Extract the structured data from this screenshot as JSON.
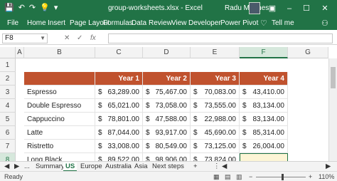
{
  "window": {
    "title": "group-worksheets.xlsx - Excel",
    "user": "Radu Meghes"
  },
  "ribbon": {
    "tabs": [
      "File",
      "Home",
      "Insert",
      "Page Layout",
      "Formulas",
      "Data",
      "Review",
      "View",
      "Developer",
      "Power Pivot"
    ],
    "tell_me": "Tell me"
  },
  "formula_bar": {
    "name_box": "F8",
    "fx": "fx",
    "content": ""
  },
  "grid": {
    "columns": [
      "A",
      "B",
      "C",
      "D",
      "E",
      "F",
      "G"
    ],
    "rows": [
      "1",
      "2",
      "3",
      "4",
      "5",
      "6",
      "7",
      "8"
    ],
    "headers": [
      "Year 1",
      "Year 2",
      "Year 3",
      "Year 4"
    ],
    "data": [
      {
        "label": "Espresso",
        "values": [
          "63,289.00",
          "75,467.00",
          "70,083.00",
          "43,410.00"
        ]
      },
      {
        "label": "Double Espresso",
        "values": [
          "65,021.00",
          "73,058.00",
          "73,555.00",
          "83,134.00"
        ]
      },
      {
        "label": "Cappuccino",
        "values": [
          "78,801.00",
          "47,588.00",
          "22,988.00",
          "83,134.00"
        ]
      },
      {
        "label": "Latte",
        "values": [
          "87,044.00",
          "93,917.00",
          "45,690.00",
          "85,314.00"
        ]
      },
      {
        "label": "Ristretto",
        "values": [
          "33,008.00",
          "80,549.00",
          "73,125.00",
          "26,004.00"
        ]
      },
      {
        "label": "Long Black",
        "values": [
          "89,522.00",
          "98,906.00",
          "73,824.00",
          ""
        ]
      }
    ],
    "currency": "$",
    "header_color": "#c0522e",
    "accent_color": "#217346"
  },
  "sheets": {
    "ellipsis": "...",
    "tabs": [
      "Summary",
      "US",
      "Europe",
      "Australia",
      "Asia",
      "Next steps"
    ],
    "active": "US",
    "add": "+"
  },
  "status": {
    "ready": "Ready",
    "zoom": "110%"
  }
}
